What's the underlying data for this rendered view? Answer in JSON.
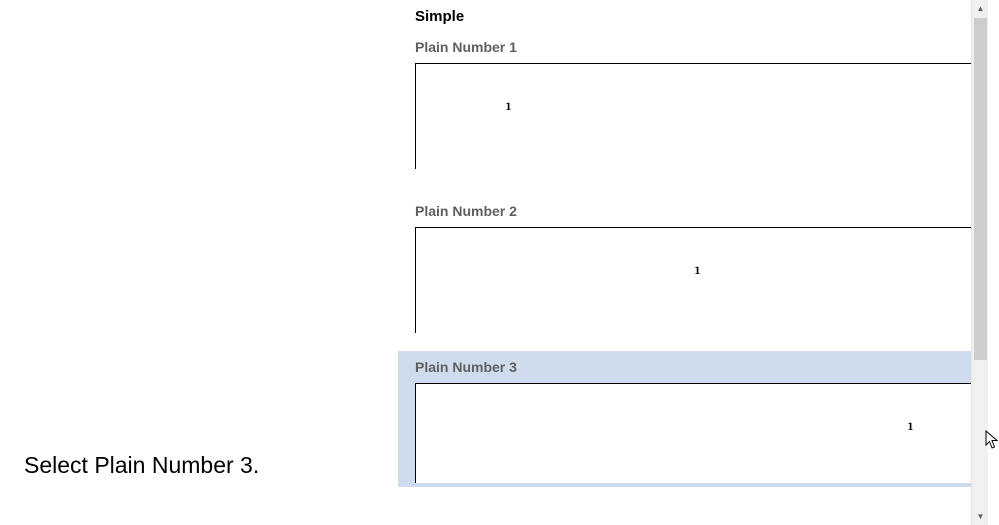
{
  "instruction": "Select Plain Number 3.",
  "gallery": {
    "section_header": "Simple",
    "options": [
      {
        "label": "Plain Number 1",
        "preview_value": "1",
        "alignment": "left",
        "selected": false
      },
      {
        "label": "Plain Number 2",
        "preview_value": "1",
        "alignment": "center",
        "selected": false
      },
      {
        "label": "Plain Number 3",
        "preview_value": "1",
        "alignment": "right",
        "selected": true
      }
    ]
  }
}
